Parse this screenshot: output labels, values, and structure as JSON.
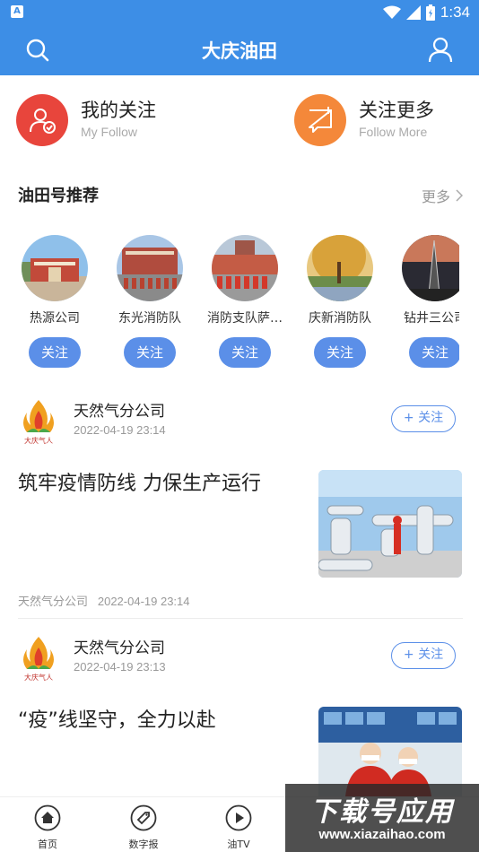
{
  "status_bar": {
    "time": "1:34",
    "notification_badge": "A"
  },
  "header": {
    "title": "大庆油田"
  },
  "follow": {
    "mine": {
      "title": "我的关注",
      "subtitle": "My Follow",
      "color": "#e8453c"
    },
    "more": {
      "title": "关注更多",
      "subtitle": "Follow  More",
      "color": "#f4883a"
    }
  },
  "section": {
    "title": "油田号推荐",
    "more_label": "更多"
  },
  "accounts": [
    {
      "name": "热源公司",
      "follow_label": "关注"
    },
    {
      "name": "东光消防队",
      "follow_label": "关注"
    },
    {
      "name": "消防支队萨…",
      "follow_label": "关注"
    },
    {
      "name": "庆新消防队",
      "follow_label": "关注"
    },
    {
      "name": "钻井三公司",
      "follow_label": "关注"
    }
  ],
  "feed": [
    {
      "author": "天然气分公司",
      "author_time": "2022-04-19 23:14",
      "follow_label": "+ 关注",
      "headline": "筑牢疫情防线 力保生产运行",
      "meta_source": "天然气分公司",
      "meta_time": "2022-04-19 23:14"
    },
    {
      "author": "天然气分公司",
      "author_time": "2022-04-19 23:13",
      "follow_label": "+ 关注",
      "headline": "“疫”线坚守，全力以赴"
    }
  ],
  "logo_text": "大庆气人",
  "nav": [
    {
      "label": "首页"
    },
    {
      "label": "数字报"
    },
    {
      "label": "油TV"
    }
  ],
  "watermark": {
    "title": "下载号应用",
    "url": "www.xiazaihao.com"
  },
  "colors": {
    "primary": "#3d8ee6",
    "button": "#5b8fe8"
  }
}
